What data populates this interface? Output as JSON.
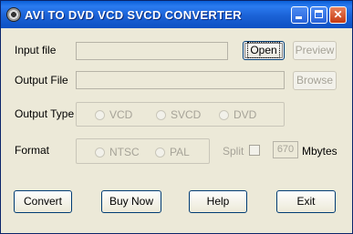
{
  "window": {
    "title": "AVI TO DVD VCD SVCD CONVERTER",
    "controls": [
      "minimize",
      "maximize",
      "close"
    ]
  },
  "input": {
    "label": "Input file",
    "value": "",
    "open_label": "Open",
    "preview_label": "Preview"
  },
  "output": {
    "label": "Output File",
    "value": "",
    "browse_label": "Browse"
  },
  "output_type": {
    "label": "Output Type",
    "options": [
      "VCD",
      "SVCD",
      "DVD"
    ]
  },
  "format": {
    "label": "Format",
    "options": [
      "NTSC",
      "PAL"
    ],
    "split_label": "Split",
    "split_checked": false,
    "split_value": "670",
    "split_unit": "Mbytes"
  },
  "buttons": {
    "convert": "Convert",
    "buy_now": "Buy Now",
    "help": "Help",
    "exit": "Exit"
  },
  "icons": {
    "app": "film-reel-icon",
    "minimize": "minimize-icon",
    "maximize": "maximize-icon",
    "close": "close-icon"
  }
}
